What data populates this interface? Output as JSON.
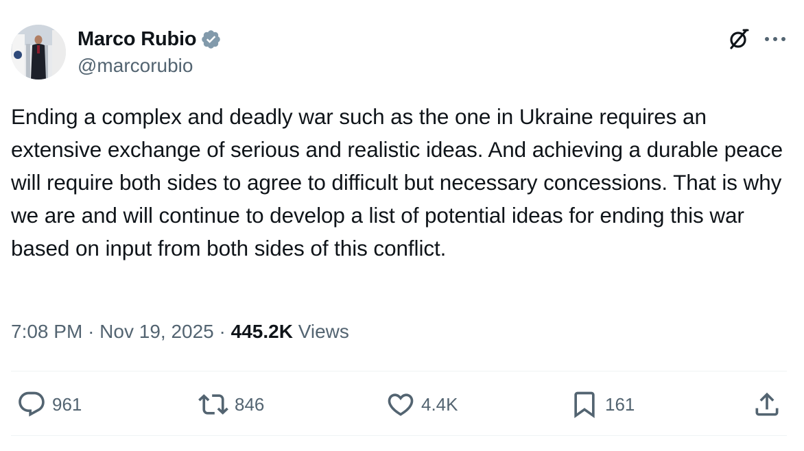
{
  "author": {
    "display_name": "Marco Rubio",
    "handle": "@marcorubio",
    "verified": true,
    "verified_color": "#829aab"
  },
  "header_icons": {
    "grok": "grok-icon",
    "more": "more-options-icon"
  },
  "tweet": {
    "text": "Ending a complex and deadly war such as the one in Ukraine requires an extensive exchange of serious and realistic ideas. And achieving a durable peace will require both sides to agree to difficult but necessary concessions. That is why we are and will continue to develop a list of potential ideas for ending this war based on input from both sides of this conflict.",
    "time": "7:08 PM",
    "separator": "·",
    "date": "Nov 19, 2025",
    "views_count": "445.2K",
    "views_label": "Views"
  },
  "actions": {
    "reply": {
      "icon": "reply-icon",
      "count": "961"
    },
    "repost": {
      "icon": "repost-icon",
      "count": "846"
    },
    "like": {
      "icon": "heart-icon",
      "count": "4.4K"
    },
    "bookmark": {
      "icon": "bookmark-icon",
      "count": "161"
    },
    "share": {
      "icon": "share-icon"
    }
  },
  "colors": {
    "text": "#0f1419",
    "secondary": "#536471",
    "divider": "#eff3f4"
  }
}
